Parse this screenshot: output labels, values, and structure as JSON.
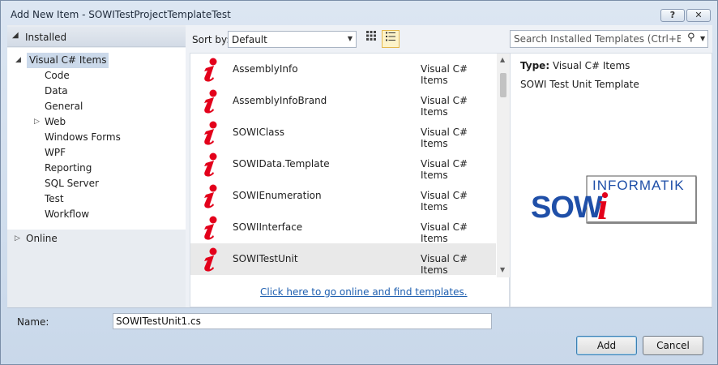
{
  "window": {
    "title": "Add New Item - SOWITestProjectTemplateTest",
    "help_label": "?",
    "close_label": "✕"
  },
  "sidebar": {
    "installed_label": "Installed",
    "root_label": "Visual C# Items",
    "items": [
      {
        "label": "Code"
      },
      {
        "label": "Data"
      },
      {
        "label": "General"
      },
      {
        "label": "Web"
      },
      {
        "label": "Windows Forms"
      },
      {
        "label": "WPF"
      },
      {
        "label": "Reporting"
      },
      {
        "label": "SQL Server"
      },
      {
        "label": "Test"
      },
      {
        "label": "Workflow"
      }
    ],
    "online_label": "Online"
  },
  "toolbar": {
    "sort_label": "Sort by:",
    "sort_value": "Default",
    "search_placeholder": "Search Installed Templates (Ctrl+E)"
  },
  "templates": [
    {
      "name": "AssemblyInfo",
      "category": "Visual C# Items"
    },
    {
      "name": "AssemblyInfoBrand",
      "category": "Visual C# Items"
    },
    {
      "name": "SOWIClass",
      "category": "Visual C# Items"
    },
    {
      "name": "SOWIData.Template",
      "category": "Visual C# Items"
    },
    {
      "name": "SOWIEnumeration",
      "category": "Visual C# Items"
    },
    {
      "name": "SOWIInterface",
      "category": "Visual C# Items"
    },
    {
      "name": "SOWITestUnit",
      "category": "Visual C# Items",
      "selected": true
    }
  ],
  "online_link": "Click here to go online and find templates.",
  "details": {
    "type_key": "Type:",
    "type_value": "Visual C# Items",
    "description": "SOWI Test Unit Template",
    "logo_top": "INFORMATIK",
    "logo_main": "SOW",
    "logo_i": "i"
  },
  "footer": {
    "name_label": "Name:",
    "name_value": "SOWITestUnit1.cs",
    "add_label": "Add",
    "cancel_label": "Cancel"
  },
  "colors": {
    "accent": "#1e5fb0",
    "brand_blue": "#1f4fa8",
    "brand_red": "#e3001b",
    "selection": "#cbd9ea"
  }
}
